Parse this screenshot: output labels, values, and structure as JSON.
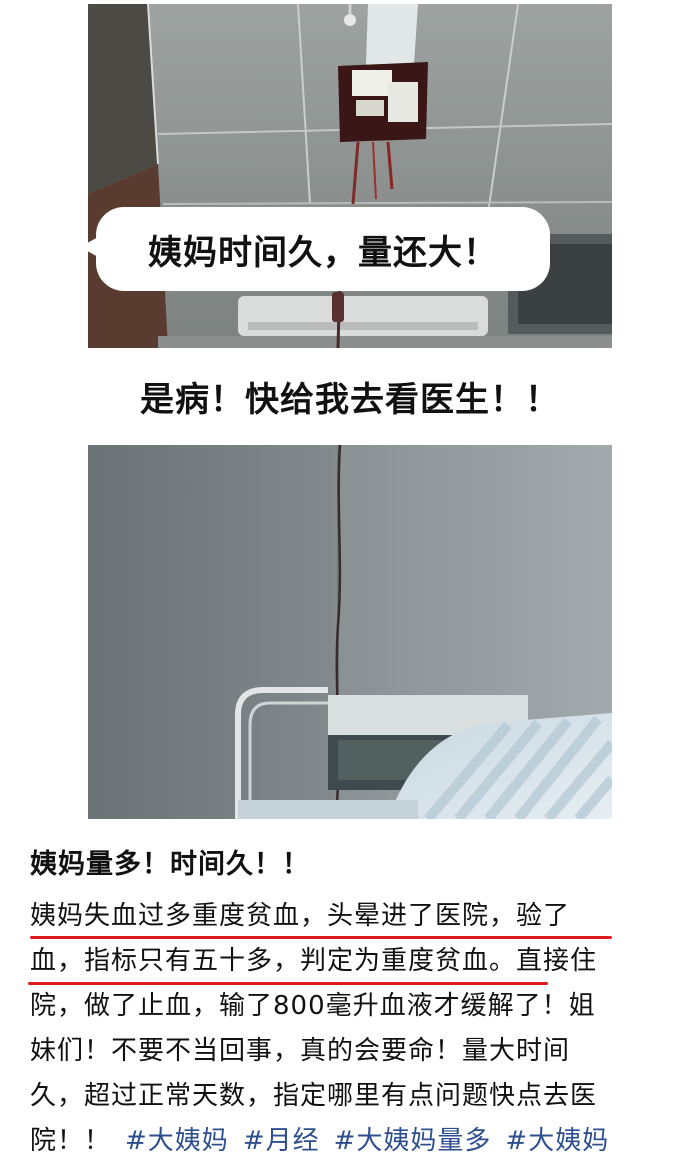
{
  "photo1": {
    "bubble_text": "姨妈时间久，量还大！"
  },
  "headline": "是病！快给我去看医生！！",
  "post": {
    "title": "姨妈量多！时间久！！",
    "lines": [
      "姨妈失血过多重度贫血，头晕进了医院，验了",
      "血，指标只有五十多，判定为重度贫血。直接住",
      "院，做了止血，输了800毫升血液才缓解了！姐",
      "妹们！不要不当回事，真的会要命！量大时间",
      "久，超过正常天数，指定哪里有点问题快点去医"
    ],
    "last_line_text": "院！！",
    "hashtags": [
      "#大姨妈",
      "#月经",
      "#大姨妈量多",
      "#大姨妈"
    ]
  },
  "colors": {
    "underline": "#e0191d",
    "hashtag": "#2e4f8f"
  }
}
